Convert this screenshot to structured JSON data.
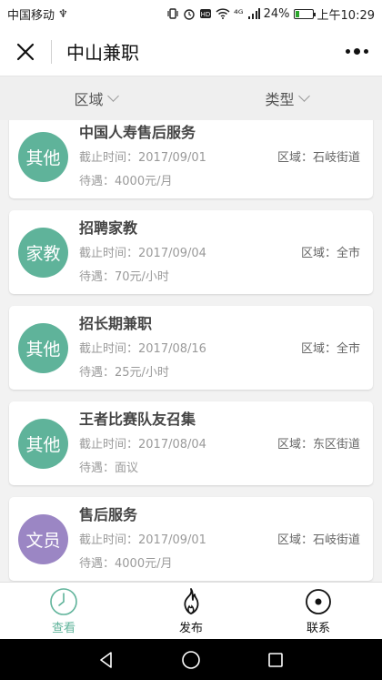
{
  "status_bar": {
    "carrier": "中国移动",
    "usb_symbol": "♆",
    "signal_text": "⁴ᴳ",
    "battery_text": "24%",
    "battery_level": 0.24,
    "time": "上午10:29"
  },
  "header": {
    "title": "中山兼职"
  },
  "filters": {
    "area": "区域",
    "type": "类型"
  },
  "jobs": [
    {
      "badge": "其他",
      "badge_color": "#5fb39a",
      "title": "中国人寿售后服务",
      "deadline": "截止时间：2017/09/01",
      "salary": "待遇：4000元/月",
      "area": "区域：石岐街道"
    },
    {
      "badge": "家教",
      "badge_color": "#5fb39a",
      "title": "招聘家教",
      "deadline": "截止时间：2017/09/04",
      "salary": "待遇：70元/小时",
      "area": "区域：全市"
    },
    {
      "badge": "其他",
      "badge_color": "#5fb39a",
      "title": "招长期兼职",
      "deadline": "截止时间：2017/08/16",
      "salary": "待遇：25元/小时",
      "area": "区域：全市"
    },
    {
      "badge": "其他",
      "badge_color": "#5fb39a",
      "title": "王者比赛队友召集",
      "deadline": "截止时间：2017/08/04",
      "salary": "待遇：面议",
      "area": "区域：东区街道"
    },
    {
      "badge": "文员",
      "badge_color": "#9b86c4",
      "title": "售后服务",
      "deadline": "截止时间：2017/09/01",
      "salary": "待遇：4000元/月",
      "area": "区域：石岐街道"
    }
  ],
  "tabs": [
    {
      "label": "查看",
      "icon": "clock-icon",
      "active": true
    },
    {
      "label": "发布",
      "icon": "flame-icon",
      "active": false
    },
    {
      "label": "联系",
      "icon": "target-icon",
      "active": false
    }
  ],
  "colors": {
    "accent": "#5fb39a",
    "purple_badge": "#9b86c4"
  }
}
